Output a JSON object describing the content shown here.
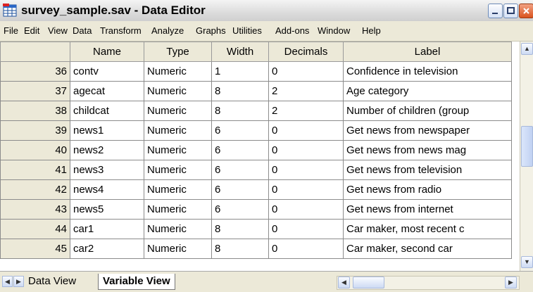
{
  "window": {
    "title": "survey_sample.sav - Data Editor",
    "app_icon": "spss-grid-icon",
    "controls": [
      "minimize-icon",
      "maximize-icon",
      "close-icon"
    ]
  },
  "menu": [
    {
      "label": "File"
    },
    {
      "label": "Edit"
    },
    {
      "label": "View"
    },
    {
      "label": "Data"
    },
    {
      "label": "Transform"
    },
    {
      "label": "Analyze"
    },
    {
      "label": "Graphs"
    },
    {
      "label": "Utilities"
    },
    {
      "label": "Add-ons"
    },
    {
      "label": "Window"
    },
    {
      "label": "Help"
    }
  ],
  "grid": {
    "columns": [
      "Name",
      "Type",
      "Width",
      "Decimals",
      "Label"
    ],
    "rows": [
      {
        "num": "36",
        "name": "contv",
        "type": "Numeric",
        "width": "1",
        "decimals": "0",
        "label": "Confidence in television"
      },
      {
        "num": "37",
        "name": "agecat",
        "type": "Numeric",
        "width": "8",
        "decimals": "2",
        "label": "Age category"
      },
      {
        "num": "38",
        "name": "childcat",
        "type": "Numeric",
        "width": "8",
        "decimals": "2",
        "label": "Number of children (group"
      },
      {
        "num": "39",
        "name": "news1",
        "type": "Numeric",
        "width": "6",
        "decimals": "0",
        "label": "Get news from newspaper"
      },
      {
        "num": "40",
        "name": "news2",
        "type": "Numeric",
        "width": "6",
        "decimals": "0",
        "label": "Get news from news mag"
      },
      {
        "num": "41",
        "name": "news3",
        "type": "Numeric",
        "width": "6",
        "decimals": "0",
        "label": "Get news from television"
      },
      {
        "num": "42",
        "name": "news4",
        "type": "Numeric",
        "width": "6",
        "decimals": "0",
        "label": "Get news from radio"
      },
      {
        "num": "43",
        "name": "news5",
        "type": "Numeric",
        "width": "6",
        "decimals": "0",
        "label": "Get news from internet"
      },
      {
        "num": "44",
        "name": "car1",
        "type": "Numeric",
        "width": "8",
        "decimals": "0",
        "label": "Car maker, most recent c"
      },
      {
        "num": "45",
        "name": "car2",
        "type": "Numeric",
        "width": "8",
        "decimals": "0",
        "label": "Car maker, second car"
      }
    ]
  },
  "tabs": [
    {
      "label": "Data View",
      "active": false
    },
    {
      "label": "Variable View",
      "active": true
    }
  ]
}
